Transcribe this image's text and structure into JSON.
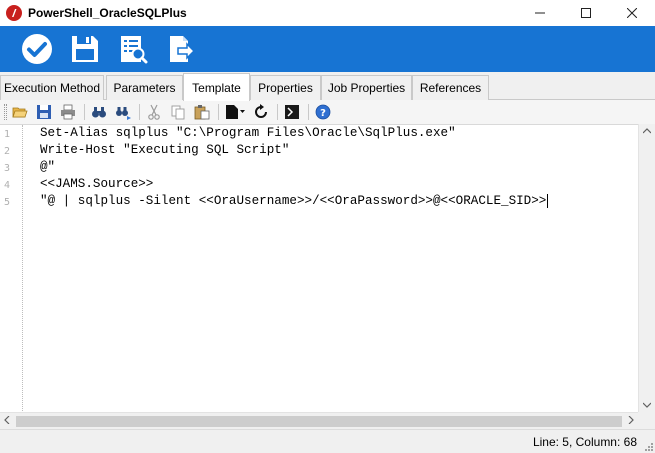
{
  "window": {
    "title": "PowerShell_OracleSQLPlus",
    "app_icon": "powershell-job-icon",
    "controls": [
      "minimize-icon",
      "maximize-icon",
      "close-icon"
    ]
  },
  "ribbon": {
    "accent_color": "#1774d3",
    "buttons": [
      "check-icon",
      "save-icon",
      "validate-document-icon",
      "export-icon"
    ]
  },
  "tabs": [
    {
      "label": "Execution Method",
      "active": false
    },
    {
      "label": "Parameters",
      "active": false
    },
    {
      "label": "Template",
      "active": true
    },
    {
      "label": "Properties",
      "active": false
    },
    {
      "label": "Job Properties",
      "active": false
    },
    {
      "label": "References",
      "active": false
    }
  ],
  "editor_toolbar": {
    "icons": [
      "open-folder-icon",
      "save-icon",
      "print-icon",
      "find-icon",
      "find-next-icon",
      "cut-icon",
      "copy-icon",
      "paste-icon",
      "new-document-dropdown-icon",
      "redo-icon",
      "powershell-icon",
      "help-icon"
    ]
  },
  "editor": {
    "line_numbers": [
      "1",
      "2",
      "3",
      "4",
      "5"
    ],
    "lines": [
      "Set-Alias sqlplus \"C:\\Program Files\\Oracle\\SqlPlus.exe\"",
      "Write-Host \"Executing SQL Script\"",
      "@\"",
      "<<JAMS.Source>>",
      "\"@ | sqlplus -Silent <<OraUsername>>/<<OraPassword>>@<<ORACLE_SID>>"
    ]
  },
  "status": {
    "position": "Line: 5, Column: 68"
  }
}
